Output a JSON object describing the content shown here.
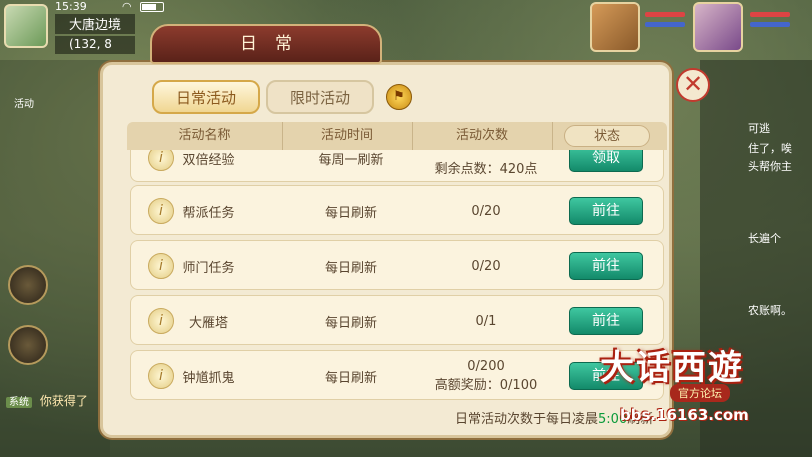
{
  "hud": {
    "time": "15:39",
    "zone": "大唐边境",
    "coords": "(132, 8",
    "left_label": "活动",
    "chat_tag": "系统",
    "chat_text": "你获得了",
    "right_texts": [
      "可逃",
      "住了，唉",
      "头帮你主",
      "长遍个",
      "农账啊。"
    ]
  },
  "panel": {
    "title": "日常",
    "tabs": [
      {
        "label": "日常活动",
        "active": true
      },
      {
        "label": "限时活动",
        "active": false
      }
    ],
    "headers": [
      "活动名称",
      "活动时间",
      "活动次数",
      "状态"
    ],
    "rows": [
      {
        "name": "双倍经验",
        "time": "每周一刷新",
        "count": "剩余点数：420点",
        "count2": "",
        "action": "领取"
      },
      {
        "name": "帮派任务",
        "time": "每日刷新",
        "count": "0/20",
        "count2": "",
        "action": "前往"
      },
      {
        "name": "师门任务",
        "time": "每日刷新",
        "count": "0/20",
        "count2": "",
        "action": "前往"
      },
      {
        "name": "大雁塔",
        "time": "每日刷新",
        "count": "0/1",
        "count2": "",
        "action": "前往"
      },
      {
        "name": "钟馗抓鬼",
        "time": "每日刷新",
        "count": "0/200",
        "count2": "高额奖励：0/100",
        "action": "前往"
      }
    ],
    "footer_prefix": "日常活动次数于每日凌晨",
    "footer_time": "5:00",
    "footer_suffix": "刷新"
  },
  "logo": {
    "main": "大话西遊",
    "sub": "官方论坛",
    "url": "bbs.16163.com"
  },
  "colors": {
    "go_button": "#1fa57f",
    "title_tab": "#7a2f24",
    "close": "#c23a2e"
  }
}
